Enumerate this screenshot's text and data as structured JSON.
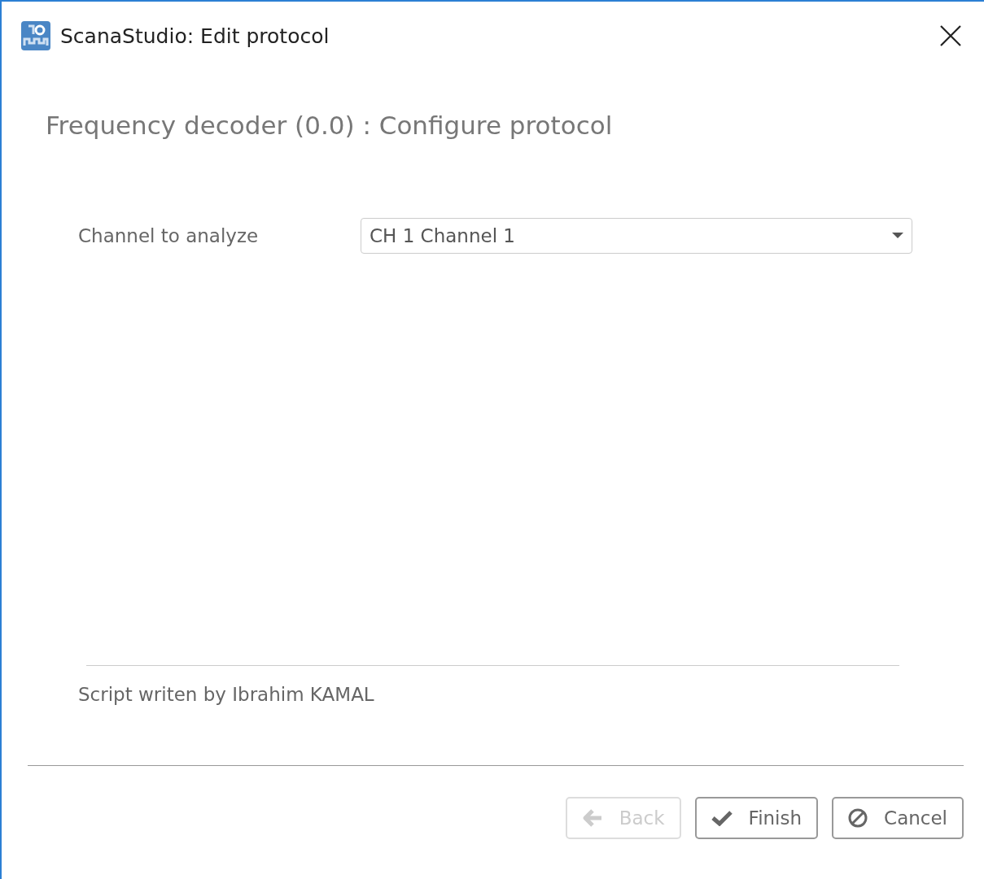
{
  "window": {
    "title": "ScanaStudio: Edit protocol"
  },
  "heading": "Frequency decoder (0.0) : Configure protocol",
  "fields": [
    {
      "label": "Channel to analyze",
      "value": "CH 1 Channel 1"
    }
  ],
  "credit": "Script writen by Ibrahim KAMAL",
  "buttons": [
    {
      "kind": "back",
      "label": "Back",
      "disabled": true
    },
    {
      "kind": "finish",
      "label": "Finish",
      "disabled": false
    },
    {
      "kind": "cancel",
      "label": "Cancel",
      "disabled": false
    }
  ]
}
